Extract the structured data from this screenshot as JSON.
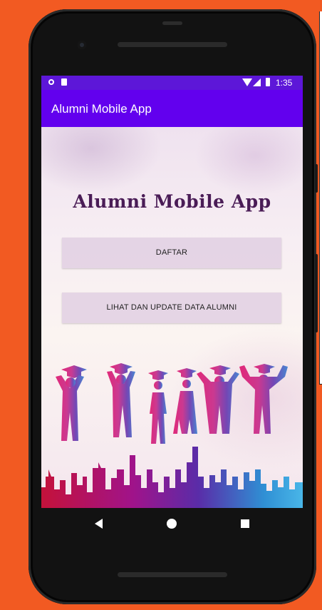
{
  "status_bar": {
    "time": "1:35"
  },
  "app_bar": {
    "title": "Alumni Mobile App"
  },
  "main": {
    "heading": "Alumni Mobile App",
    "buttons": {
      "daftar": "DAFTAR",
      "lihat": "LIHAT DAN UPDATE DATA ALUMNI"
    }
  },
  "colors": {
    "status_bar": "#5d17d8",
    "app_bar": "#6200ee",
    "heading": "#4a1c56",
    "page_background": "#f25a22"
  },
  "icons": {
    "status": [
      "notification-dot-icon",
      "sd-card-icon",
      "wifi-icon",
      "signal-icon",
      "battery-icon"
    ],
    "nav": [
      "back-icon",
      "home-icon",
      "recent-apps-icon"
    ]
  }
}
